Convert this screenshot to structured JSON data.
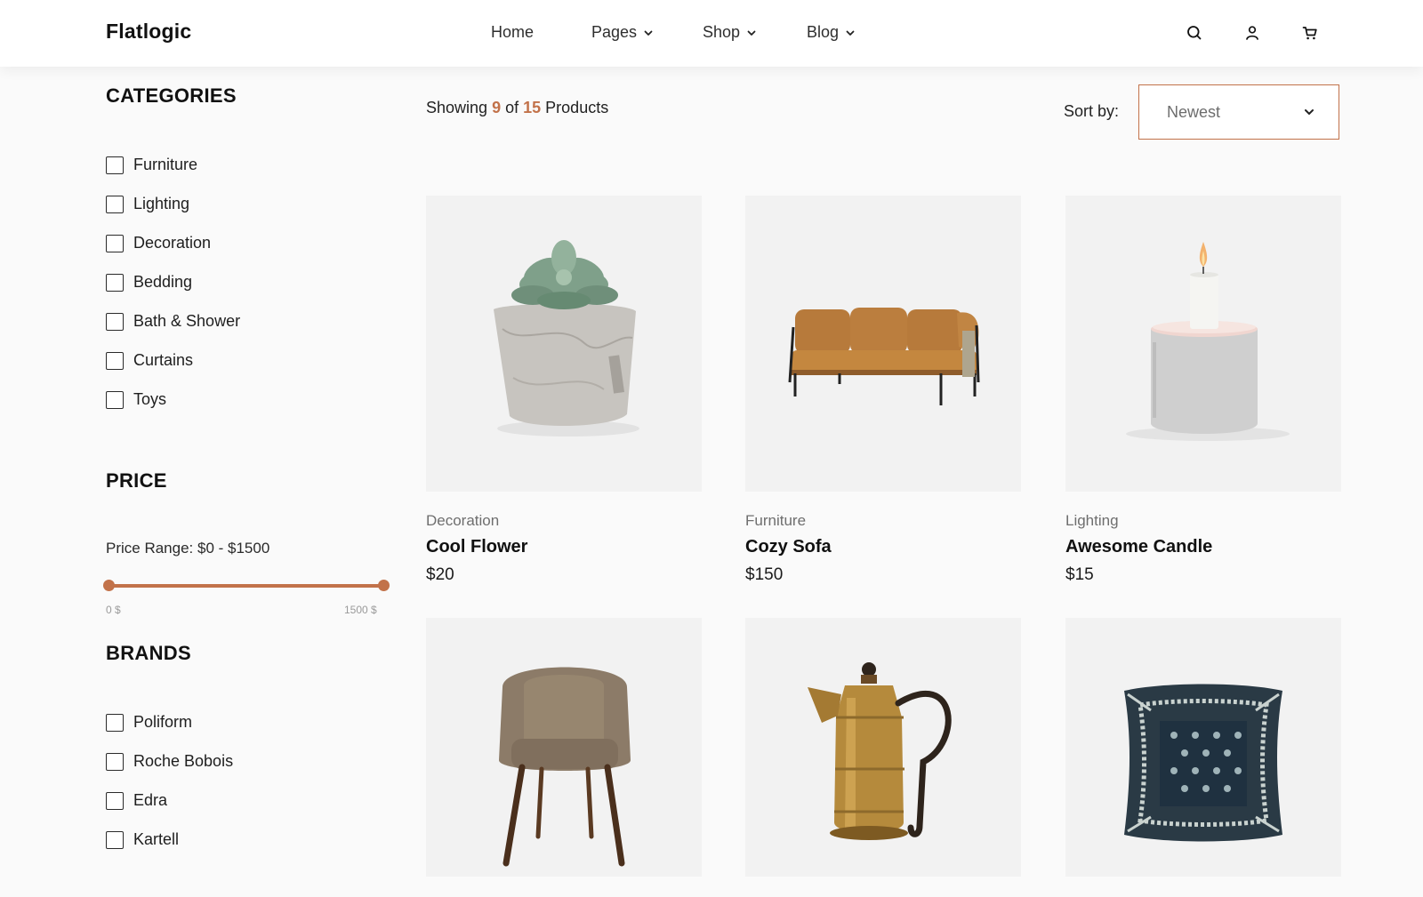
{
  "header": {
    "logo": "Flatlogic",
    "nav": [
      {
        "label": "Home",
        "has_dropdown": false
      },
      {
        "label": "Pages",
        "has_dropdown": true
      },
      {
        "label": "Shop",
        "has_dropdown": true
      },
      {
        "label": "Blog",
        "has_dropdown": true
      }
    ],
    "icons": [
      "search-icon",
      "user-icon",
      "cart-icon"
    ]
  },
  "sidebar": {
    "categories_title": "CATEGORIES",
    "categories": [
      "Furniture",
      "Lighting",
      "Decoration",
      "Bedding",
      "Bath & Shower",
      "Curtains",
      "Toys"
    ],
    "price_title": "PRICE",
    "price_range_text": "Price Range: $0 - $1500",
    "slider": {
      "min_label": "0 $",
      "max_label": "1500 $",
      "min_value": 0,
      "max_value": 1500,
      "low": 0,
      "high": 1500
    },
    "brands_title": "BRANDS",
    "brands": [
      "Poliform",
      "Roche Bobois",
      "Edra",
      "Kartell"
    ]
  },
  "toolbar": {
    "showing_prefix": "Showing",
    "showing_count": "9",
    "showing_of": "of",
    "showing_total": "15",
    "showing_suffix": "Products",
    "sort_label": "Sort by:",
    "sort_value": "Newest"
  },
  "products": [
    {
      "category": "Decoration",
      "name": "Cool Flower",
      "price": "$20",
      "image": "potted-succulent"
    },
    {
      "category": "Furniture",
      "name": "Cozy Sofa",
      "price": "$150",
      "image": "leather-sofa"
    },
    {
      "category": "Lighting",
      "name": "Awesome Candle",
      "price": "$15",
      "image": "candle-holder"
    },
    {
      "category": "",
      "name": "",
      "price": "",
      "image": "armchair"
    },
    {
      "category": "",
      "name": "",
      "price": "",
      "image": "brass-kettle"
    },
    {
      "category": "",
      "name": "",
      "price": "",
      "image": "pillow"
    }
  ],
  "colors": {
    "accent": "#c2724a",
    "card_bg": "#f2f2f2",
    "page_bg": "#fafafa"
  }
}
